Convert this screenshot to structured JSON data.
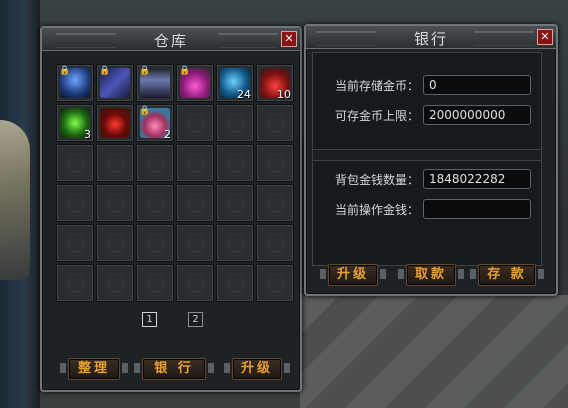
{
  "warehouse": {
    "title": "仓库",
    "close_label": "✕",
    "items": [
      {
        "name": "armor-blue",
        "locked": true,
        "qty": ""
      },
      {
        "name": "boots-dark",
        "locked": true,
        "qty": ""
      },
      {
        "name": "armor-silver",
        "locked": true,
        "qty": ""
      },
      {
        "name": "potion-pink",
        "locked": true,
        "qty": ""
      },
      {
        "name": "gem-blue",
        "locked": false,
        "qty": "24"
      },
      {
        "name": "potion-red",
        "locked": false,
        "qty": "10"
      },
      {
        "name": "gem-green",
        "locked": false,
        "qty": "3"
      },
      {
        "name": "blood-drops",
        "locked": false,
        "qty": ""
      },
      {
        "name": "potion-jar",
        "locked": true,
        "qty": "2"
      }
    ],
    "pages": [
      "1",
      "2"
    ],
    "buttons": {
      "sort": "整理",
      "bank": "银 行",
      "upgrade": "升级"
    }
  },
  "bank": {
    "title": "银行",
    "close_label": "✕",
    "stored_gold_label": "当前存储金币：",
    "stored_gold_value": "0",
    "limit_label": "可存金币上限：",
    "limit_value": "2000000000",
    "bag_money_label": "背包金钱数量：",
    "bag_money_value": "1848022282",
    "operate_label": "当前操作金钱：",
    "operate_value": "",
    "buttons": {
      "upgrade": "升级",
      "withdraw": "取款",
      "deposit": "存 款"
    }
  },
  "colors": {
    "accent": "#e8a030",
    "close": "#8a1212"
  }
}
